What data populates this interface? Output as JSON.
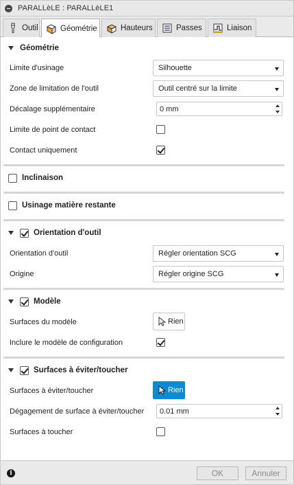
{
  "window": {
    "title": "PARALLèLE : PARALLèLE1"
  },
  "tabs": [
    {
      "label": "Outil",
      "icon": "tool-icon"
    },
    {
      "label": "Géométrie",
      "icon": "geometry-icon",
      "active": true
    },
    {
      "label": "Hauteurs",
      "icon": "heights-icon"
    },
    {
      "label": "Passes",
      "icon": "passes-icon"
    },
    {
      "label": "Liaison",
      "icon": "linking-icon"
    }
  ],
  "geometry": {
    "title": "Géométrie",
    "machining_boundary": {
      "label": "Limite d'usinage",
      "value": "Silhouette"
    },
    "tool_containment": {
      "label": "Zone de limitation de l'outil",
      "value": "Outil centré sur la limite"
    },
    "additional_offset": {
      "label": "Décalage supplémentaire",
      "value": "0 mm"
    },
    "contact_point_boundary": {
      "label": "Limite de point de contact",
      "checked": false
    },
    "contact_only": {
      "label": "Contact uniquement",
      "checked": true
    }
  },
  "slope": {
    "title": "Inclinaison",
    "checked": false
  },
  "rest_machining": {
    "title": "Usinage matière restante",
    "checked": false
  },
  "tool_orientation": {
    "title": "Orientation d'outil",
    "checked": true,
    "orientation": {
      "label": "Orientation d'outil",
      "value": "Régler orientation SCG"
    },
    "origin": {
      "label": "Origine",
      "value": "Régler origine SCG"
    }
  },
  "model": {
    "title": "Modèle",
    "checked": true,
    "surfaces": {
      "label": "Surfaces du modèle",
      "button": "Rien"
    },
    "include_setup_model": {
      "label": "Inclure le modèle de configuration",
      "checked": true
    }
  },
  "avoid_touch": {
    "title": "Surfaces à éviter/toucher",
    "checked": true,
    "surfaces": {
      "label": "Surfaces à éviter/toucher",
      "button": "Rien"
    },
    "clearance": {
      "label": "Dégagement de surface à éviter/toucher",
      "value": "0.01 mm"
    },
    "touch_surfaces": {
      "label": "Surfaces à toucher",
      "checked": false
    }
  },
  "footer": {
    "ok": "OK",
    "cancel": "Annuler"
  },
  "colors": {
    "accent": "#0a8bd6",
    "tab_bg": "#eaeaea",
    "separator": "#d6d6d6"
  }
}
